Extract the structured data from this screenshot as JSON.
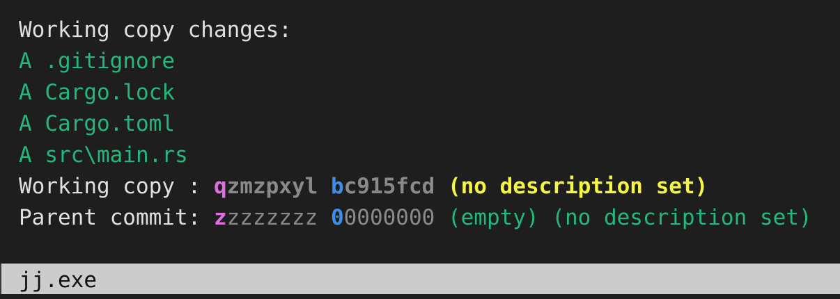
{
  "terminal": {
    "heading": "Working copy changes:",
    "changes": [
      {
        "status": "A",
        "path": ".gitignore"
      },
      {
        "status": "A",
        "path": "Cargo.lock"
      },
      {
        "status": "A",
        "path": "Cargo.toml"
      },
      {
        "status": "A",
        "path": "src\\main.rs"
      }
    ],
    "working_copy": {
      "label": "Working copy : ",
      "change_id_prefix": "q",
      "change_id_rest": "zmzpxyl",
      "commit_id_prefix": "b",
      "commit_id_rest": "c915fcd",
      "description": "(no description set)"
    },
    "parent_commit": {
      "label": "Parent commit: ",
      "change_id_prefix": "z",
      "change_id_rest": "zzzzzzz",
      "commit_id_prefix": "0",
      "commit_id_rest": "0000000",
      "empty_marker": "(empty)",
      "description": "(no description set)"
    }
  },
  "window": {
    "title": "jj.exe"
  },
  "colors": {
    "background": "#1e1e1e",
    "green": "#23b97c",
    "magenta": "#e070e0",
    "blue": "#3b8eea",
    "yellow": "#f5f543",
    "gray": "#8a8a8a",
    "title_bar": "#cccccc"
  }
}
